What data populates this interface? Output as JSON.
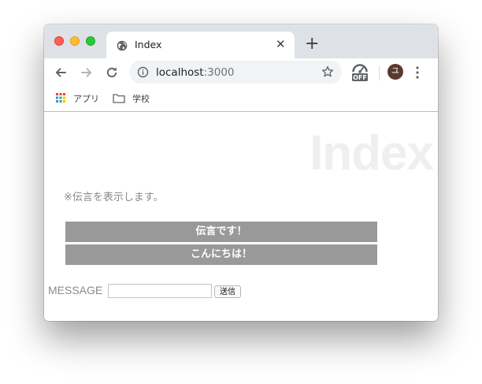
{
  "tab": {
    "title": "Index"
  },
  "address": {
    "host": "localhost",
    "port": ":3000"
  },
  "extension": {
    "badge": "OFF"
  },
  "profile": {
    "initial": "ユ"
  },
  "bookmarks": {
    "apps": "アプリ",
    "school": "学校"
  },
  "page": {
    "heading": "Index",
    "notice": "※伝言を表示します。",
    "messages": [
      "伝言です！",
      "こんにちは！"
    ],
    "form": {
      "label": "MESSAGE",
      "input_value": "",
      "submit_label": "送信"
    }
  },
  "colors": {
    "message_bg": "#999999",
    "heading": "#efefef",
    "tabstrip": "#dee1e6"
  }
}
